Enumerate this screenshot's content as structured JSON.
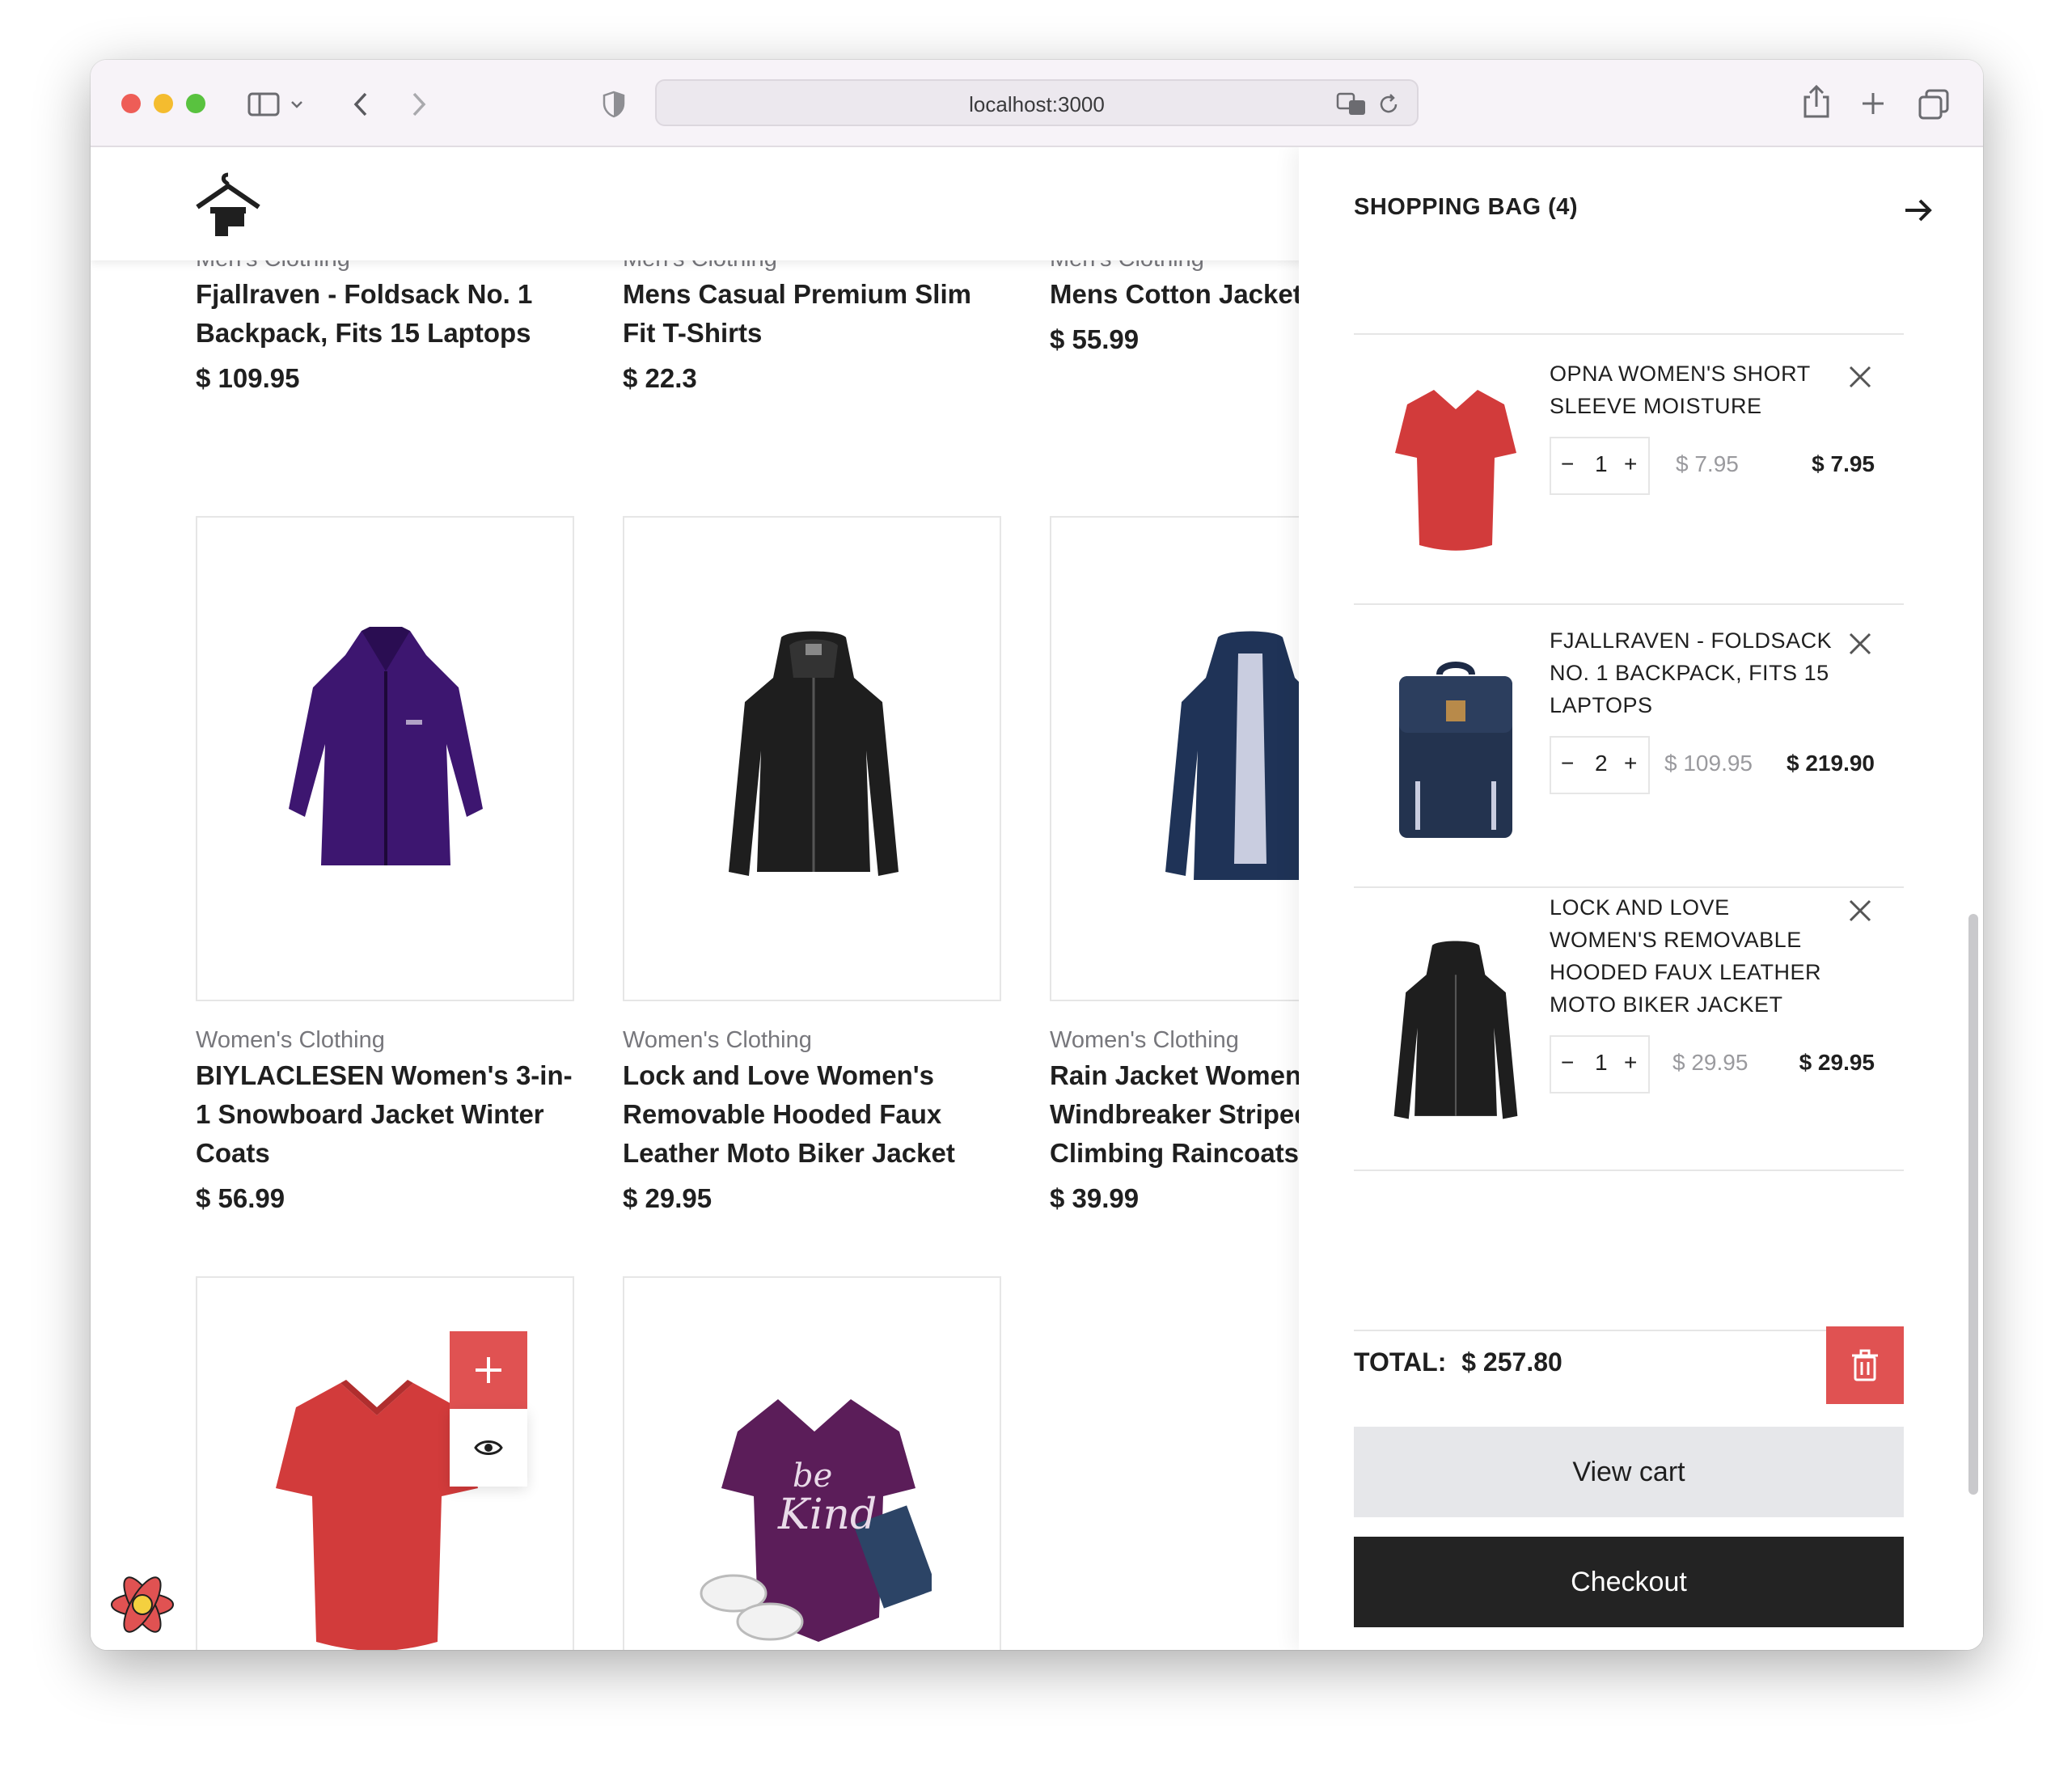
{
  "browser": {
    "url": "localhost:3000"
  },
  "products_top_row": [
    {
      "category": "Men's Clothing",
      "title_lines": [
        "Fjallraven - Foldsack No. 1",
        "Backpack, Fits 15 Laptops"
      ],
      "price": "$ 109.95"
    },
    {
      "category": "Men's Clothing",
      "title_lines": [
        "Mens Casual Premium Slim",
        "Fit T-Shirts"
      ],
      "price": "$ 22.3"
    },
    {
      "category": "Men's Clothing",
      "title_lines": [
        "Mens Cotton Jacket"
      ],
      "price": "$ 55.99"
    }
  ],
  "products_mid_row": [
    {
      "category": "Women's Clothing",
      "title_lines": [
        "BIYLACLESEN Women's 3-in-",
        "1 Snowboard Jacket Winter",
        "Coats"
      ],
      "price": "$ 56.99",
      "image": "purple-jacket"
    },
    {
      "category": "Women's Clothing",
      "title_lines": [
        "Lock and Love Women's",
        "Removable Hooded Faux",
        "Leather Moto Biker Jacket"
      ],
      "price": "$ 29.95",
      "image": "black-leather-jacket"
    },
    {
      "category": "Women's Clothing",
      "title_lines": [
        "Rain Jacket Women",
        "Windbreaker Striped",
        "Climbing Raincoats"
      ],
      "price": "$ 39.99",
      "image": "navy-raincoat"
    }
  ],
  "products_bottom_row": [
    {
      "image": "red-tshirt"
    },
    {
      "image": "purple-be-kind-tshirt"
    }
  ],
  "cart": {
    "title": "SHOPPING BAG (4)",
    "items": [
      {
        "name_lines": [
          "OPNA WOMEN'S SHORT",
          "SLEEVE MOISTURE"
        ],
        "qty": "1",
        "unit_price": "$ 7.95",
        "line_total": "$ 7.95",
        "image": "red-tshirt"
      },
      {
        "name_lines": [
          "FJALLRAVEN - FOLDSACK",
          "NO. 1 BACKPACK, FITS 15",
          "LAPTOPS"
        ],
        "qty": "2",
        "unit_price": "$ 109.95",
        "line_total": "$ 219.90",
        "image": "navy-backpack"
      },
      {
        "name_lines": [
          "LOCK AND LOVE",
          "WOMEN'S REMOVABLE",
          "HOODED FAUX LEATHER",
          "MOTO BIKER JACKET"
        ],
        "qty": "1",
        "unit_price": "$ 29.95",
        "line_total": "$ 29.95",
        "image": "black-leather-jacket"
      }
    ],
    "total_label": "TOTAL:",
    "total_value": "$ 257.80",
    "view_cart_label": "View cart",
    "checkout_label": "Checkout"
  },
  "colors": {
    "accent": "#e05252",
    "dark": "#232323",
    "light_button": "#e6e7ea"
  },
  "print_shirt_text": [
    "be",
    "Kind"
  ]
}
